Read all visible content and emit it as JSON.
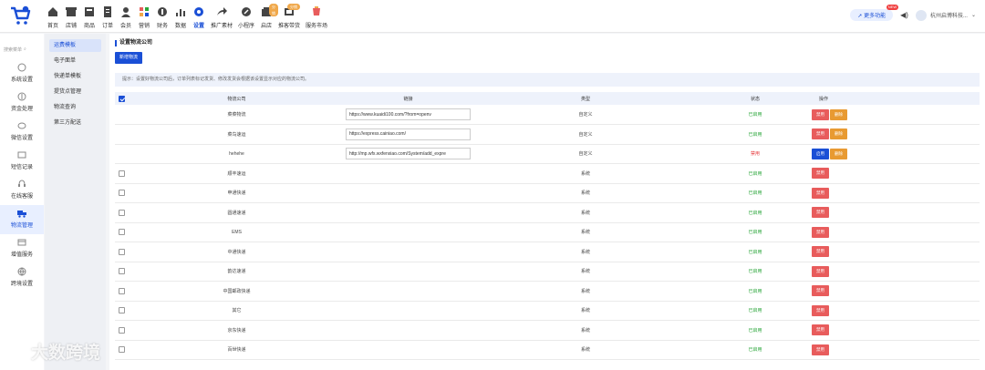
{
  "nav": {
    "items": [
      {
        "label": "首页",
        "icon": "home-icon"
      },
      {
        "label": "店铺",
        "icon": "store-icon"
      },
      {
        "label": "商品",
        "icon": "goods-icon"
      },
      {
        "label": "订单",
        "icon": "order-icon"
      },
      {
        "label": "会员",
        "icon": "member-icon"
      },
      {
        "label": "营销",
        "icon": "marketing-icon"
      },
      {
        "label": "财务",
        "icon": "finance-icon"
      },
      {
        "label": "数据",
        "icon": "data-icon"
      },
      {
        "label": "设置",
        "icon": "settings-icon",
        "active": true
      },
      {
        "label": "推广素材",
        "icon": "share-icon"
      },
      {
        "label": "小程序",
        "icon": "miniapp-icon"
      },
      {
        "label": "启店",
        "icon": "shop-icon",
        "badge": "分销"
      },
      {
        "label": "推客带货",
        "icon": "promoter-icon",
        "badge": "分销"
      },
      {
        "label": "服务市场",
        "icon": "market-icon"
      }
    ],
    "upgrade_label": "更多功能",
    "upgrade_badge": "NEW",
    "company": "杭州启博科技..."
  },
  "sidebar": {
    "search_placeholder": "搜索菜单",
    "items": [
      {
        "label": "系统设置",
        "icon": "system-icon"
      },
      {
        "label": "资金处理",
        "icon": "funds-icon"
      },
      {
        "label": "微信设置",
        "icon": "wechat-icon"
      },
      {
        "label": "短信记录",
        "icon": "sms-icon"
      },
      {
        "label": "在线客服",
        "icon": "service-icon"
      },
      {
        "label": "物流管理",
        "icon": "logistics-icon",
        "active": true
      },
      {
        "label": "增值服务",
        "icon": "value-icon"
      },
      {
        "label": "跨境设置",
        "icon": "crossborder-icon"
      }
    ]
  },
  "submenu": {
    "items": [
      {
        "label": "运费模板",
        "active": true
      },
      {
        "label": "电子面单"
      },
      {
        "label": "快递单模板"
      },
      {
        "label": "提货点管理"
      },
      {
        "label": "物流查询"
      },
      {
        "label": "第三方配送"
      }
    ]
  },
  "main": {
    "title": "设置物流公司",
    "add_button": "新增物流",
    "tip": "提示：设置好物流公司后，订单列表标记发货、修改发货会根据该设置显示对应的物流公司。",
    "headers": {
      "company": "物流公司",
      "link": "链接",
      "type": "类型",
      "status": "状态",
      "ops": "操作"
    },
    "rows": [
      {
        "company": "菜菜物流",
        "link": "https://www.kuaidi100.com/?from=openv",
        "type": "自定义",
        "status": "已启用",
        "on": true,
        "ops": [
          "禁用",
          "删除"
        ],
        "nocheck": true
      },
      {
        "company": "菜鸟速运",
        "link": "https://express.cainiao.com/",
        "type": "自定义",
        "status": "已启用",
        "on": true,
        "ops": [
          "禁用",
          "删除"
        ],
        "nocheck": true
      },
      {
        "company": "hehehe",
        "link": "http://mp.wfx.wxfenxiao.com/System/add_expre",
        "type": "自定义",
        "status": "禁用",
        "on": false,
        "ops": [
          "启用",
          "删除"
        ],
        "nocheck": true
      },
      {
        "company": "顺丰速运",
        "type": "系统",
        "status": "已启用",
        "on": true,
        "ops": [
          "禁用"
        ]
      },
      {
        "company": "申通快递",
        "type": "系统",
        "status": "已启用",
        "on": true,
        "ops": [
          "禁用"
        ]
      },
      {
        "company": "圆通速递",
        "type": "系统",
        "status": "已启用",
        "on": true,
        "ops": [
          "禁用"
        ]
      },
      {
        "company": "EMS",
        "type": "系统",
        "status": "已启用",
        "on": true,
        "ops": [
          "禁用"
        ]
      },
      {
        "company": "中通快递",
        "type": "系统",
        "status": "已启用",
        "on": true,
        "ops": [
          "禁用"
        ]
      },
      {
        "company": "韵达速递",
        "type": "系统",
        "status": "已启用",
        "on": true,
        "ops": [
          "禁用"
        ]
      },
      {
        "company": "中国邮政快递",
        "type": "系统",
        "status": "已启用",
        "on": true,
        "ops": [
          "禁用"
        ]
      },
      {
        "company": "其它",
        "type": "系统",
        "status": "已启用",
        "on": true,
        "ops": [
          "禁用"
        ]
      },
      {
        "company": "京东快递",
        "type": "系统",
        "status": "已启用",
        "on": true,
        "ops": [
          "禁用"
        ]
      },
      {
        "company": "百世快递",
        "type": "系统",
        "status": "已启用",
        "on": true,
        "ops": [
          "禁用"
        ]
      }
    ]
  },
  "watermark": "大数跨境",
  "colors": {
    "accent": "#1a4fd6",
    "on": "#2aa63a",
    "off": "#e5383b",
    "danger": "#e85c5c",
    "warn": "#e89a32"
  }
}
